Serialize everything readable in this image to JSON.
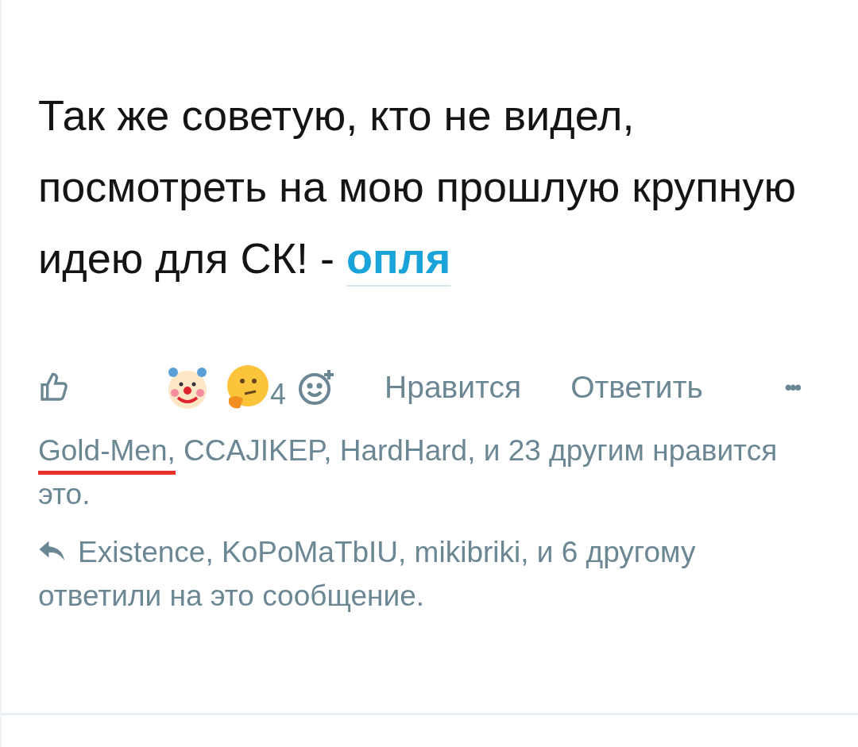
{
  "post": {
    "lines": [
      "Так же советую, кто не видел,",
      "посмотреть на мою прошлую крупную",
      "идею для СК! -"
    ],
    "link": "опля"
  },
  "reactions": [
    {
      "kind": "clown"
    },
    {
      "kind": "thinking",
      "count": "4"
    }
  ],
  "actions": [
    "Нравится",
    "Ответить"
  ],
  "more": "•••",
  "likes": {
    "parts": [
      {
        "text": "Gold-Men,",
        "annotated": true
      },
      {
        "text": " CCAJIKEP, HardHard, и 23 другим нравится это.",
        "annotated": false
      }
    ]
  },
  "replies": {
    "text": "Existence, KoPoMaTbIU, mikibriki, и 6 другому ответили на это сообщение."
  }
}
